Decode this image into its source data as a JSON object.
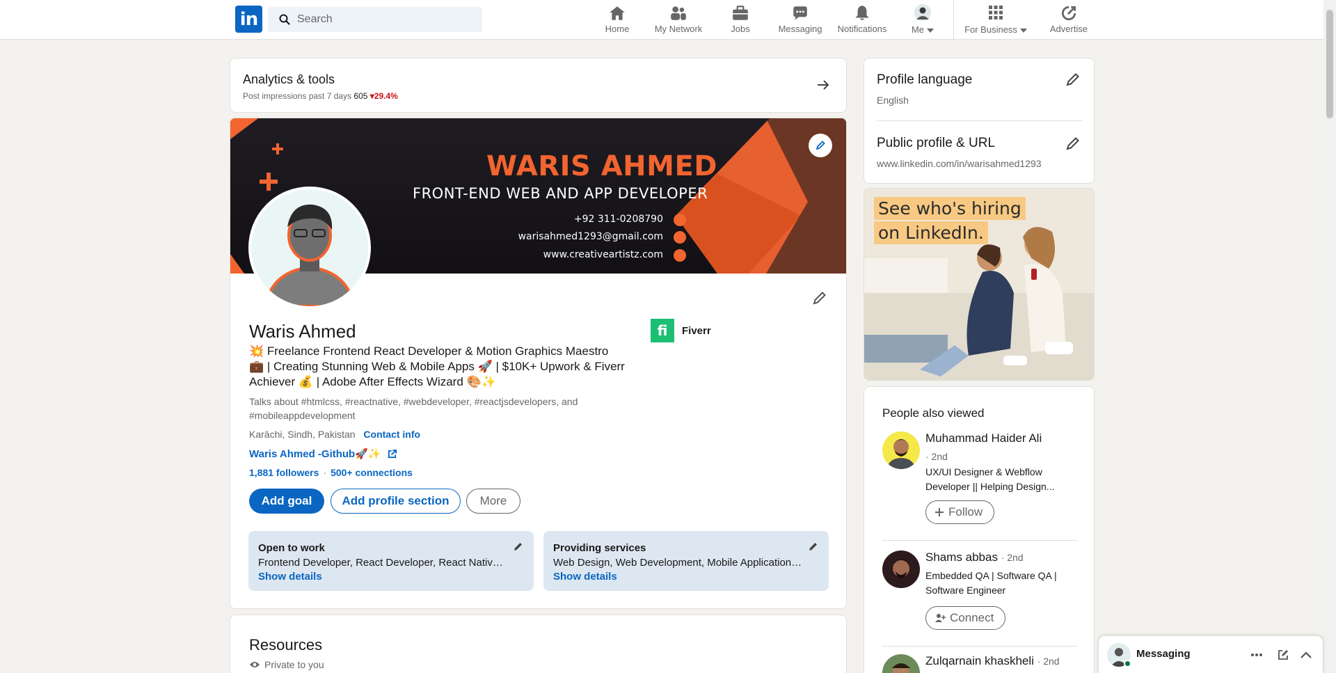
{
  "nav": {
    "logo": "in",
    "search_placeholder": "Search",
    "items": [
      {
        "label": "Home",
        "icon": "home-icon"
      },
      {
        "label": "My Network",
        "icon": "network-icon"
      },
      {
        "label": "Jobs",
        "icon": "briefcase-icon"
      },
      {
        "label": "Messaging",
        "icon": "messaging-icon"
      },
      {
        "label": "Notifications",
        "icon": "bell-icon"
      },
      {
        "label": "Me",
        "icon": "avatar"
      },
      {
        "label": "For Business",
        "icon": "grid-icon"
      },
      {
        "label": "Advertise",
        "icon": "advertise-icon"
      }
    ]
  },
  "analytics": {
    "title": "Analytics & tools",
    "subtitle": "Post impressions past 7 days",
    "value": "605",
    "change": "29.4%"
  },
  "banner": {
    "name": "WARIS AHMED",
    "role": "FRONT-END WEB AND APP DEVELOPER",
    "phone": "+92 311-0208790",
    "email": "warisahmed1293@gmail.com",
    "website": "www.creativeartistz.com"
  },
  "profile": {
    "name": "Waris Ahmed",
    "headline": "💥 Freelance Frontend React Developer & Motion Graphics Maestro 💼 | Creating Stunning Web & Mobile Apps 🚀 | $10K+ Upwork & Fiverr Achiever 💰 | Adobe After Effects Wizard 🎨✨",
    "talks": "Talks about #htmlcss, #reactnative, #webdeveloper, #reactjsdevelopers, and #mobileappdevelopment",
    "location": "Karāchi, Sindh, Pakistan",
    "contact_label": "Contact info",
    "github_label": "Waris Ahmed -Github🚀✨",
    "followers": "1,881 followers",
    "connections": "500+ connections",
    "company": "Fiverr",
    "company_logo": "fi"
  },
  "actions": {
    "add_goal": "Add goal",
    "add_section": "Add profile section",
    "more": "More"
  },
  "open_to_work": {
    "title": "Open to work",
    "desc": "Frontend Developer, React Developer, React Native Developer",
    "link": "Show details"
  },
  "providing_services": {
    "title": "Providing services",
    "desc": "Web Design, Web Development, Mobile Application Development",
    "link": "Show details"
  },
  "resources": {
    "title": "Resources",
    "privacy": "Private to you"
  },
  "sidebar": {
    "profile_language_title": "Profile language",
    "profile_language_value": "English",
    "public_profile_title": "Public profile & URL",
    "public_profile_url": "www.linkedin.com/in/warisahmed1293",
    "ad_line1": "See who's hiring",
    "ad_line2": "on LinkedIn."
  },
  "people": {
    "title": "People also viewed",
    "list": [
      {
        "name": "Muhammad Haider Ali",
        "degree": "· 2nd",
        "headline": "UX/UI Designer & Webflow Developer || Helping Design...",
        "action": "Follow"
      },
      {
        "name": "Shams abbas",
        "degree": "· 2nd",
        "headline": "Embedded QA | Software QA | Software Engineer",
        "action": "Connect"
      },
      {
        "name": "Zulqarnain khaskheli",
        "degree": "· 2nd"
      }
    ]
  },
  "messaging": {
    "label": "Messaging"
  },
  "colors": {
    "brand": "#0a66c2",
    "banner_accent": "#f26430",
    "fiverr": "#1dbf73",
    "negative": "#cc1016"
  }
}
